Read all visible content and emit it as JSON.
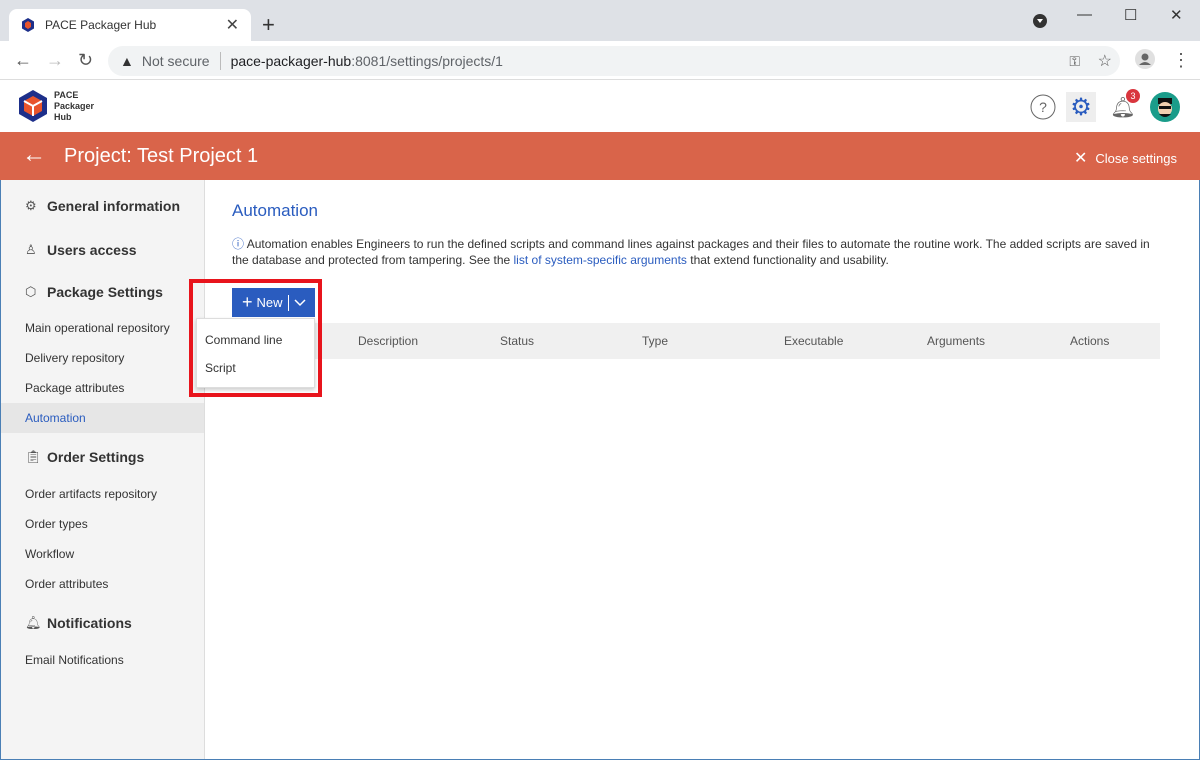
{
  "browser": {
    "tab_title": "PACE Packager Hub",
    "security": "Not secure",
    "url_host": "pace-packager-hub",
    "url_path": ":8081/settings/projects/1"
  },
  "app": {
    "logo_lines": [
      "PACE",
      "Packager",
      "Hub"
    ],
    "notification_count": "3"
  },
  "header": {
    "title": "Project: Test Project 1",
    "close_label": "Close settings"
  },
  "sidebar": {
    "sections": [
      {
        "label": "General information",
        "icon": "gear-icon"
      },
      {
        "label": "Users access",
        "icon": "users-icon"
      },
      {
        "label": "Package Settings",
        "icon": "box-icon"
      },
      {
        "label": "Order Settings",
        "icon": "clipboard-icon"
      },
      {
        "label": "Notifications",
        "icon": "bell-icon"
      }
    ],
    "package_items": [
      "Main operational repository",
      "Delivery repository",
      "Package attributes",
      "Automation"
    ],
    "order_items": [
      "Order artifacts repository",
      "Order types",
      "Workflow",
      "Order attributes"
    ],
    "notification_items": [
      "Email Notifications"
    ],
    "active": "Automation"
  },
  "main": {
    "title": "Automation",
    "description_pre": "Automation enables Engineers to run the defined scripts and command lines against packages and their files to automate the routine work. The added scripts are saved in the database and protected from tampering. See the ",
    "description_link": "list of system-specific arguments",
    "description_post": " that extend functionality and usability.",
    "new_label": "New",
    "menu": [
      "Command line",
      "Script"
    ],
    "columns": [
      "Description",
      "Status",
      "Type",
      "Executable",
      "Arguments",
      "Actions"
    ]
  },
  "colors": {
    "accent": "#2a5cbf",
    "header": "#d9644a",
    "highlight": "#e8141c"
  }
}
